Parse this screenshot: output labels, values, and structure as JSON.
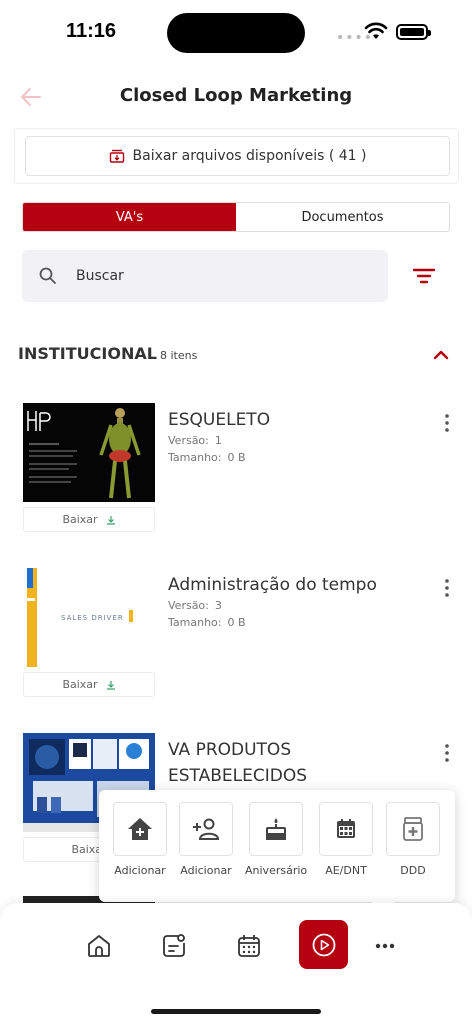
{
  "status": {
    "time": "11:16"
  },
  "header": {
    "title": "Closed Loop Marketing"
  },
  "download_all": {
    "label": "Baixar arquivos disponíveis ( 41 )"
  },
  "tabs": [
    {
      "label": "VA's",
      "active": true
    },
    {
      "label": "Documentos",
      "active": false
    }
  ],
  "search": {
    "placeholder": "Buscar"
  },
  "section": {
    "title": "INSTITUCIONAL",
    "count": "8 itens"
  },
  "meta_labels": {
    "version": "Versão:",
    "size": "Tamanho:"
  },
  "items": [
    {
      "title": "ESQUELETO",
      "version": "1",
      "size": "0 B",
      "download_label": "Baixar"
    },
    {
      "title": "Administração do tempo",
      "version": "3",
      "size": "0 B",
      "download_label": "Baixar",
      "thumb_text": "SALES DRIVER"
    },
    {
      "title": "VA PRODUTOS ESTABELECIDOS",
      "download_label": "Baixar"
    }
  ],
  "popup_actions": [
    {
      "label": "Adicionar",
      "icon": "add-home-icon"
    },
    {
      "label": "Adicionar",
      "icon": "add-person-icon"
    },
    {
      "label": "Aniversário",
      "icon": "cake-icon"
    },
    {
      "label": "AE/DNT",
      "icon": "calendar-icon"
    },
    {
      "label": "DDD",
      "icon": "medical-box-icon"
    }
  ],
  "bottom_nav": [
    "home-icon",
    "notes-icon",
    "calendar-icon",
    "play-icon",
    "more-icon"
  ],
  "colors": {
    "accent": "#b5000f",
    "back_arrow": "#f2c2c6"
  }
}
